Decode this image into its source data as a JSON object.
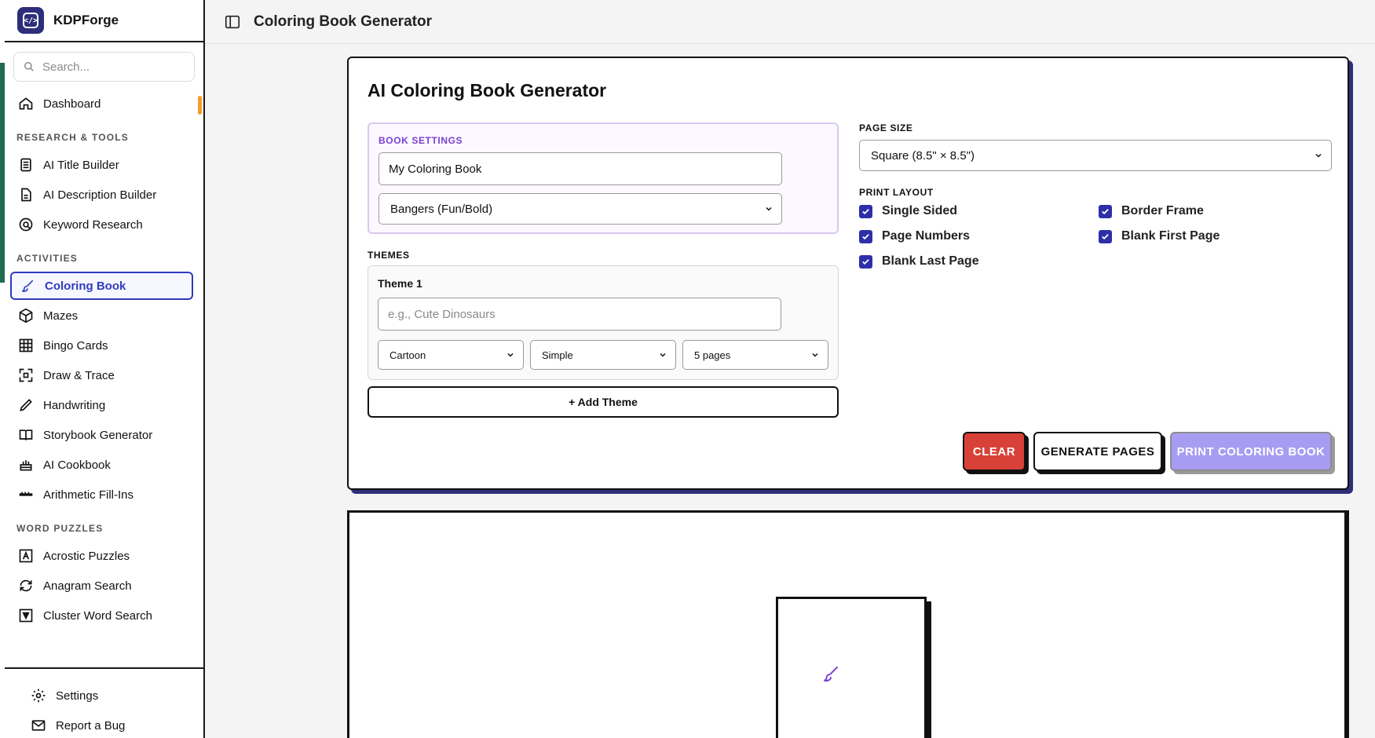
{
  "app": {
    "name": "KDPForge",
    "page_title": "Coloring Book Generator"
  },
  "search": {
    "placeholder": "Search..."
  },
  "sidebar": {
    "top_items": [
      {
        "label": "Dashboard",
        "icon": "home-icon"
      }
    ],
    "sections": [
      {
        "title": "RESEARCH & TOOLS",
        "items": [
          {
            "label": "AI Title Builder",
            "icon": "document-icon"
          },
          {
            "label": "AI Description Builder",
            "icon": "file-text-icon"
          },
          {
            "label": "Keyword Research",
            "icon": "at-search-icon"
          }
        ]
      },
      {
        "title": "ACTIVITIES",
        "items": [
          {
            "label": "Coloring Book",
            "icon": "brush-icon",
            "active": true
          },
          {
            "label": "Mazes",
            "icon": "cube-icon"
          },
          {
            "label": "Bingo Cards",
            "icon": "grid-icon"
          },
          {
            "label": "Draw & Trace",
            "icon": "expand-icon"
          },
          {
            "label": "Handwriting",
            "icon": "pencil-icon"
          },
          {
            "label": "Storybook Generator",
            "icon": "book-icon"
          },
          {
            "label": "AI Cookbook",
            "icon": "cake-icon"
          },
          {
            "label": "Arithmetic Fill-Ins",
            "icon": "ruler-icon"
          }
        ]
      },
      {
        "title": "WORD PUZZLES",
        "items": [
          {
            "label": "Acrostic Puzzles",
            "icon": "letter-a-icon"
          },
          {
            "label": "Anagram Search",
            "icon": "refresh-icon"
          },
          {
            "label": "Cluster Word Search",
            "icon": "cluster-icon"
          }
        ]
      }
    ],
    "footer": [
      {
        "label": "Settings",
        "icon": "gear-icon"
      },
      {
        "label": "Report a Bug",
        "icon": "mail-icon"
      }
    ]
  },
  "card": {
    "heading": "AI Coloring Book Generator",
    "book_settings": {
      "label": "BOOK SETTINGS",
      "title_value": "My Coloring Book",
      "font_value": "Bangers (Fun/Bold)"
    },
    "themes": {
      "label": "THEMES",
      "theme_title": "Theme 1",
      "theme_placeholder": "e.g., Cute Dinosaurs",
      "style_value": "Cartoon",
      "complexity_value": "Simple",
      "pages_value": "5 pages",
      "add_label": "+ Add Theme"
    },
    "page_size": {
      "label": "PAGE SIZE",
      "value": "Square (8.5\" × 8.5\")"
    },
    "print_layout": {
      "label": "PRINT LAYOUT",
      "options": [
        {
          "label": "Single Sided",
          "checked": true
        },
        {
          "label": "Border Frame",
          "checked": true
        },
        {
          "label": "Page Numbers",
          "checked": true
        },
        {
          "label": "Blank First Page",
          "checked": true
        },
        {
          "label": "Blank Last Page",
          "checked": true
        }
      ]
    },
    "buttons": {
      "clear": "CLEAR",
      "generate": "GENERATE PAGES",
      "print": "PRINT COLORING BOOK"
    }
  },
  "colors": {
    "accent": "#2d2f7a",
    "active_nav": "#2f3bbd",
    "clear": "#d84138",
    "print": "#a79cf2",
    "purple_label": "#7a3fd0"
  }
}
